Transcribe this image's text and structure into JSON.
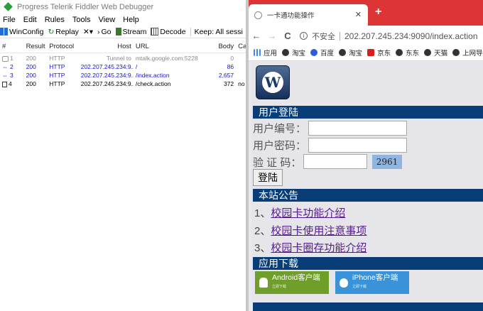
{
  "fiddler": {
    "title": "Progress Telerik Fiddler Web Debugger",
    "menu": [
      "File",
      "Edit",
      "Rules",
      "Tools",
      "View",
      "Help"
    ],
    "toolbar": {
      "winconfig": "WinConfig",
      "replay": "Replay",
      "x_menu": "✕▾",
      "go": "Go",
      "stream": "Stream",
      "decode": "Decode",
      "keep": "Keep: All sessi"
    },
    "columns": {
      "num": "#",
      "result": "Result",
      "protocol": "Protocol",
      "host": "Host",
      "url": "URL",
      "body": "Body",
      "caching": "Ca"
    },
    "sessions": [
      {
        "num": "1",
        "result": "200",
        "protocol": "HTTP",
        "host": "Tunnel to",
        "url": "mtalk.google.com:5228",
        "body": "0",
        "caching": ""
      },
      {
        "num": "2",
        "result": "200",
        "protocol": "HTTP",
        "host": "202.207.245.234:9...",
        "url": "/",
        "body": "86",
        "caching": ""
      },
      {
        "num": "3",
        "result": "200",
        "protocol": "HTTP",
        "host": "202.207.245.234:9...",
        "url": "/index.action",
        "body": "2,657",
        "caching": ""
      },
      {
        "num": "4",
        "result": "200",
        "protocol": "HTTP",
        "host": "202.207.245.234:9...",
        "url": "/check.action",
        "body": "372",
        "caching": "no"
      }
    ]
  },
  "browser": {
    "tab_title": "一卡通功能操作",
    "tab_close": "✕",
    "new_tab": "+",
    "nav": {
      "back": "←",
      "forward": "→",
      "reload": "C"
    },
    "address": {
      "info": "i",
      "insecure_label": "不安全",
      "url": "202.207.245.234:9090/index.action"
    },
    "bookmarks": [
      {
        "label": "应用",
        "color": "#4285f4"
      },
      {
        "label": "淘宝",
        "color": "#333333"
      },
      {
        "label": "百度",
        "color": "#2b5fd8"
      },
      {
        "label": "淘宝",
        "color": "#333333"
      },
      {
        "label": "京东",
        "color": "#d71c1c"
      },
      {
        "label": "东东",
        "color": "#333333"
      },
      {
        "label": "天猫",
        "color": "#333333"
      },
      {
        "label": "上网导航",
        "color": "#333333"
      }
    ]
  },
  "page": {
    "logo_letter": "W",
    "login_header": "用户登陆",
    "user_label": "用户编号：",
    "pass_label": "用户密码：",
    "code_label": "验 证 码：",
    "captcha": "2961",
    "login_button": "登陆",
    "notice_header": "本站公告",
    "notices": [
      {
        "prefix": "1、",
        "text": "校园卡功能介绍"
      },
      {
        "prefix": "2、",
        "text": "校园卡使用注意事项"
      },
      {
        "prefix": "3、",
        "text": "校园卡圈存功能介绍"
      }
    ],
    "download_header": "应用下载",
    "android": {
      "label": "Android客户端",
      "sub": "立即下载",
      "color": "#6f9f2a"
    },
    "iphone": {
      "label": "iPhone客户端",
      "sub": "立即下载",
      "color": "#3a93d8"
    }
  }
}
